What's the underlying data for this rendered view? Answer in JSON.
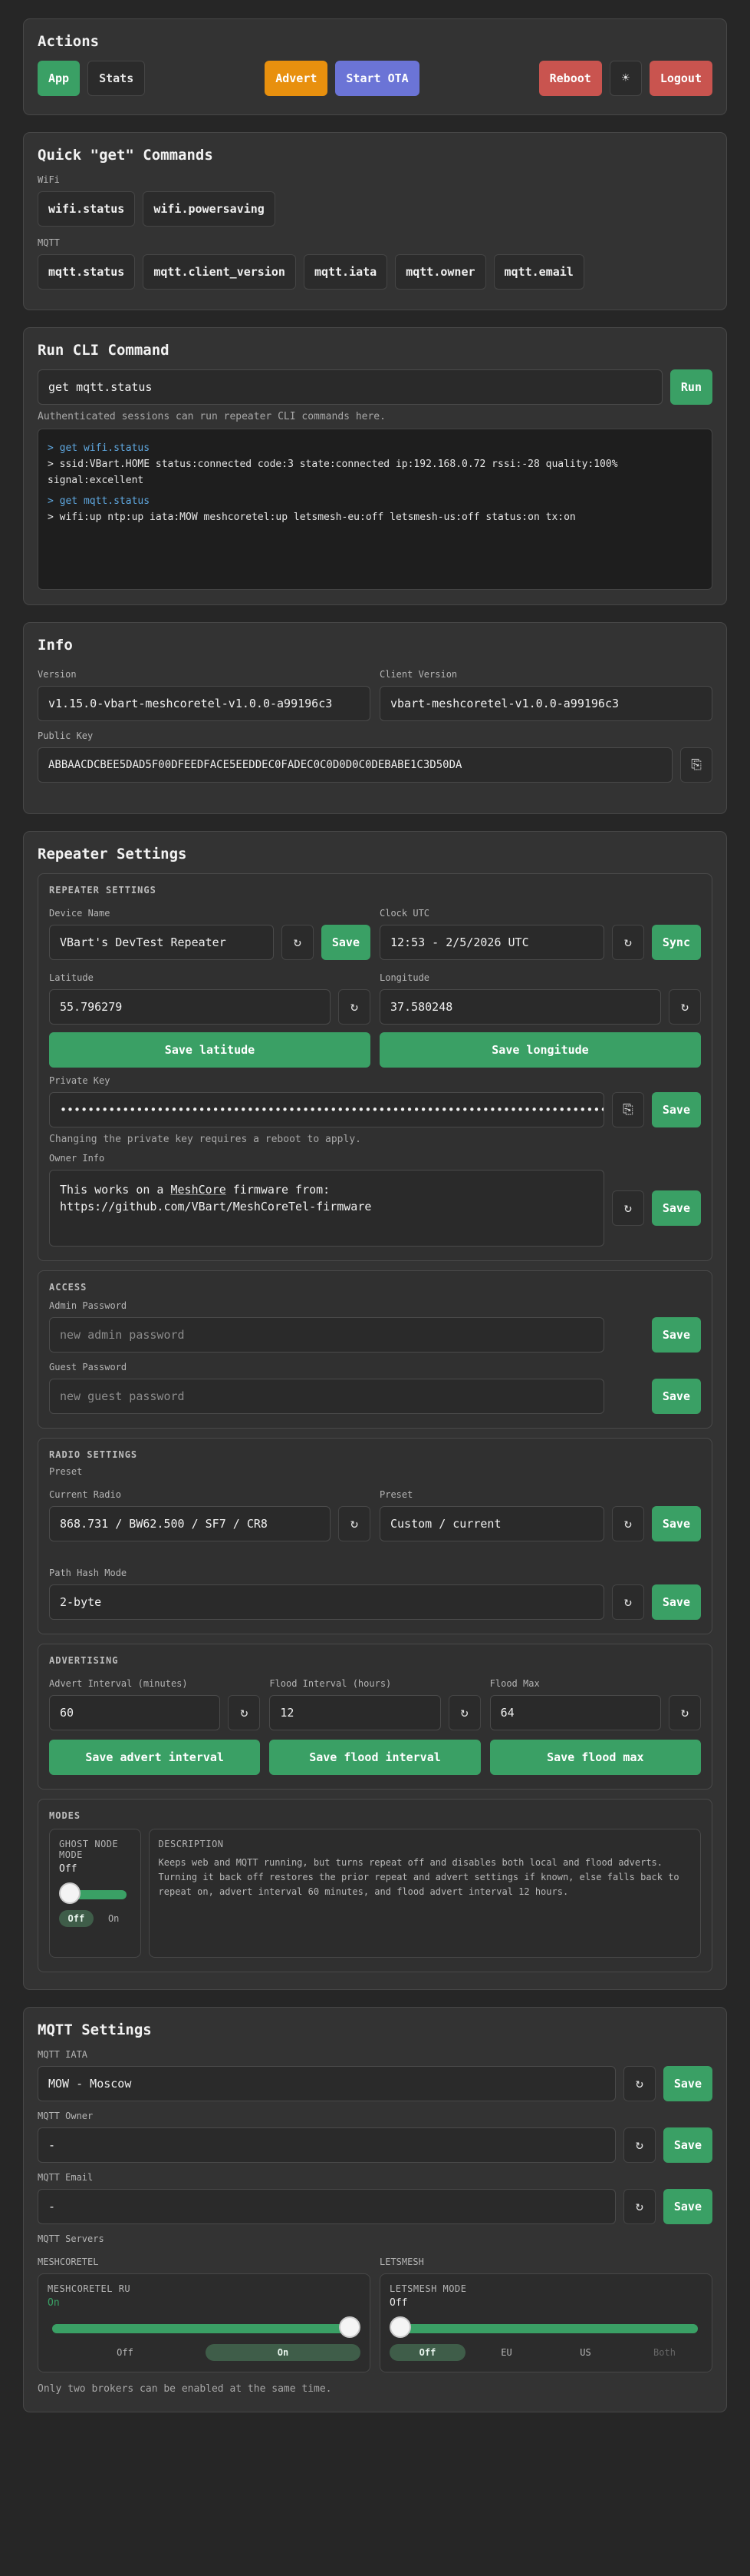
{
  "actions": {
    "title": "Actions",
    "app": "App",
    "stats": "Stats",
    "advert": "Advert",
    "start_ota": "Start OTA",
    "reboot": "Reboot",
    "theme": "☀",
    "logout": "Logout"
  },
  "quick": {
    "title": "Quick \"get\" Commands",
    "wifi_label": "WiFi",
    "wifi": [
      "wifi.status",
      "wifi.powersaving"
    ],
    "mqtt_label": "MQTT",
    "mqtt": [
      "mqtt.status",
      "mqtt.client_version",
      "mqtt.iata",
      "mqtt.owner",
      "mqtt.email"
    ]
  },
  "cli": {
    "title": "Run CLI Command",
    "input_value": "get mqtt.status",
    "run": "Run",
    "hint": "Authenticated sessions can run repeater CLI commands here.",
    "console": [
      {
        "cmd": "> get wifi.status",
        "out": "> ssid:VBart.HOME status:connected code:3 state:connected ip:192.168.0.72 rssi:-28 quality:100% signal:excellent"
      },
      {
        "cmd": "> get mqtt.status",
        "out": "> wifi:up ntp:up iata:MOW meshcoretel:up letsmesh-eu:off letsmesh-us:off status:on tx:on"
      }
    ]
  },
  "info": {
    "title": "Info",
    "version_label": "Version",
    "version": "v1.15.0-vbart-meshcoretel-v1.0.0-a99196c3",
    "client_label": "Client Version",
    "client": "vbart-meshcoretel-v1.0.0-a99196c3",
    "pubkey_label": "Public Key",
    "pubkey": "ABBAACDCBEE5DAD5F00DFEEDFACE5EEDDEC0FADEC0C0D0D0C0DEBABE1C3D50DA",
    "copy": "⎘"
  },
  "repeater": {
    "title": "Repeater Settings",
    "settings": {
      "heading": "REPEATER SETTINGS",
      "device_label": "Device Name",
      "device": "VBart's DevTest Repeater",
      "clock_label": "Clock UTC",
      "clock": "12:53 - 2/5/2026 UTC",
      "sync": "Sync",
      "lat_label": "Latitude",
      "lat": "55.796279",
      "lon_label": "Longitude",
      "lon": "37.580248",
      "save_lat": "Save latitude",
      "save_lon": "Save longitude",
      "pk_label": "Private Key",
      "pk": "••••••••••••••••••••••••••••••••••••••••••••••••••••••••••••••••••••••••••••••••••",
      "pk_hint": "Changing the private key requires a reboot to apply.",
      "owner_label": "Owner Info",
      "owner_line1a": "This works on a ",
      "owner_line1b": "MeshCore",
      "owner_line1c": " firmware from:",
      "owner_line2": "https://github.com/VBart/MeshCoreTel-firmware"
    },
    "access": {
      "heading": "ACCESS",
      "admin_label": "Admin Password",
      "admin_ph": "new admin password",
      "guest_label": "Guest Password",
      "guest_ph": "new guest password"
    },
    "radio": {
      "heading": "RADIO SETTINGS",
      "preset_heading": "Preset",
      "current_label": "Current Radio",
      "current": "868.731 / BW62.500 / SF7 / CR8",
      "preset_label": "Preset",
      "preset": "Custom / current",
      "hash_label": "Path Hash Mode",
      "hash": "2-byte"
    },
    "advertising": {
      "heading": "ADVERTISING",
      "advert_label": "Advert Interval (minutes)",
      "advert": "60",
      "flood_label": "Flood Interval (hours)",
      "flood": "12",
      "max_label": "Flood Max",
      "max": "64",
      "save_advert": "Save advert interval",
      "save_flood": "Save flood interval",
      "save_max": "Save flood max"
    },
    "modes": {
      "heading": "MODES",
      "ghost_title": "GHOST NODE MODE",
      "ghost_value": "Off",
      "ghost_level": 0,
      "off": "Off",
      "on": "On",
      "desc_title": "DESCRIPTION",
      "desc": "Keeps web and MQTT running, but turns repeat off and disables both local and flood adverts. Turning it back off restores the prior repeat and advert settings if known, else falls back to repeat on, advert interval 60 minutes, and flood advert interval 12 hours."
    },
    "save": "Save",
    "refresh": "↻"
  },
  "mqtt": {
    "title": "MQTT Settings",
    "iata_label": "MQTT IATA",
    "iata": "MOW - Moscow",
    "owner_label": "MQTT Owner",
    "owner": "-",
    "email_label": "MQTT Email",
    "email": "-",
    "servers_label": "MQTT Servers",
    "meshcoretel": {
      "col_label": "MESHCORETEL",
      "title": "MESHCORETEL RU",
      "value": "On",
      "level": 1,
      "off": "Off",
      "on": "On"
    },
    "letsmesh": {
      "col_label": "LETSMESH",
      "title": "LETSMESH MODE",
      "value": "Off",
      "options": [
        "Off",
        "EU",
        "US",
        "Both"
      ]
    },
    "footer": "Only two brokers can be enabled at the same time."
  },
  "colors": {
    "green": "#3aa065",
    "orange": "#e8900e",
    "purple": "#6b74d6",
    "red": "#c9544f"
  }
}
